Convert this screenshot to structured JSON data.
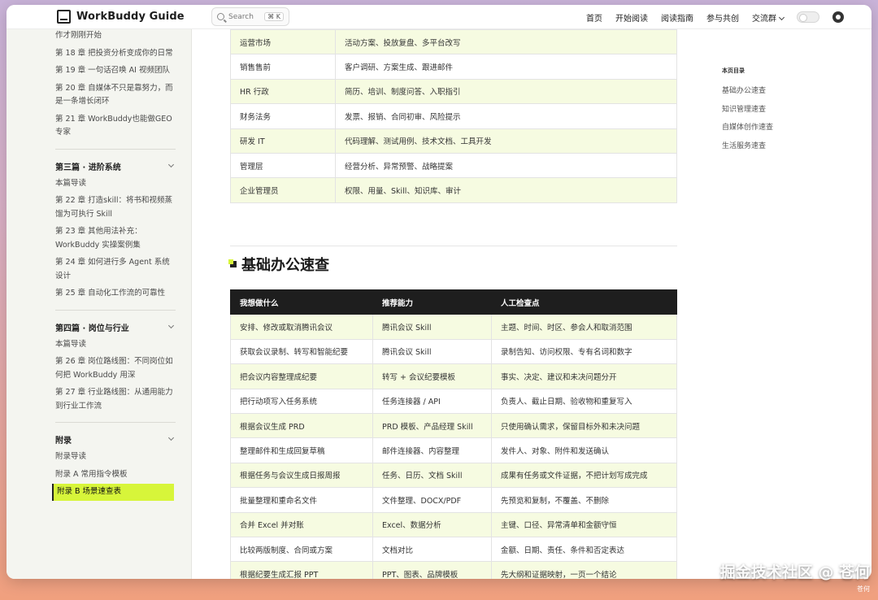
{
  "header": {
    "logo_text": "WorkBuddy Guide",
    "search_placeholder": "Search",
    "search_shortcut": "⌘ K",
    "nav": [
      "首页",
      "开始阅读",
      "阅读指南",
      "参与共创",
      "交流群"
    ]
  },
  "sidebar": {
    "top_links": [
      "作才刚刚开始",
      "第 18 章 把投资分析变成你的日常",
      "第 19 章 一句话召唤 AI 视频团队",
      "第 20 章 自媒体不只是靠努力，而是一条增长闭环",
      "第 21 章 WorkBuddy也能做GEO专家"
    ],
    "sections": [
      {
        "title": "第三篇 · 进阶系统",
        "items": [
          "本篇导读",
          "第 22 章 打造skill：将书和视频蒸馏为可执行 Skill",
          "第 23 章 其他用法补充：WorkBuddy 实操案例集",
          "第 24 章 如何进行多 Agent 系统设计",
          "第 25 章 自动化工作流的可靠性"
        ]
      },
      {
        "title": "第四篇 · 岗位与行业",
        "items": [
          "本篇导读",
          "第 26 章 岗位路线图：不同岗位如何把 WorkBuddy 用深",
          "第 27 章 行业路线图：从通用能力到行业工作流"
        ]
      },
      {
        "title": "附录",
        "items": [
          "附录导读",
          "附录 A 常用指令模板"
        ],
        "active": "附录 B 场景速查表"
      }
    ]
  },
  "roles_table": {
    "rows": [
      [
        "运营市场",
        "活动方案、投放复盘、多平台改写"
      ],
      [
        "销售售前",
        "客户调研、方案生成、跟进邮件"
      ],
      [
        "HR 行政",
        "简历、培训、制度问答、入职指引"
      ],
      [
        "财务法务",
        "发票、报销、合同初审、风险提示"
      ],
      [
        "研发 IT",
        "代码理解、测试用例、技术文档、工具开发"
      ],
      [
        "管理层",
        "经营分析、异常预警、战略提案"
      ],
      [
        "企业管理员",
        "权限、用量、Skill、知识库、审计"
      ]
    ]
  },
  "section": {
    "heading": "基础办公速查"
  },
  "office_table": {
    "headers": [
      "我想做什么",
      "推荐能力",
      "人工检查点"
    ],
    "rows": [
      [
        "安排、修改或取消腾讯会议",
        "腾讯会议 Skill",
        "主题、时间、时区、参会人和取消范围"
      ],
      [
        "获取会议录制、转写和智能纪要",
        "腾讯会议 Skill",
        "录制告知、访问权限、专有名词和数字"
      ],
      [
        "把会议内容整理成纪要",
        "转写 + 会议纪要模板",
        "事实、决定、建议和未决问题分开"
      ],
      [
        "把行动项写入任务系统",
        "任务连接器 / API",
        "负责人、截止日期、验收物和重复写入"
      ],
      [
        "根据会议生成 PRD",
        "PRD 模板、产品经理 Skill",
        "只使用确认需求，保留目标外和未决问题"
      ],
      [
        "整理邮件和生成回复草稿",
        "邮件连接器、内容整理",
        "发件人、对象、附件和发送确认"
      ],
      [
        "根据任务与会议生成日报周报",
        "任务、日历、文档 Skill",
        "成果有任务或文件证据，不把计划写成完成"
      ],
      [
        "批量整理和重命名文件",
        "文件整理、DOCX/PDF",
        "先预览和复制，不覆盖、不删除"
      ],
      [
        "合并 Excel 并对账",
        "Excel、数据分析",
        "主键、口径、异常清单和金额守恒"
      ],
      [
        "比较两版制度、合同或方案",
        "文档对比",
        "金额、日期、责任、条件和否定表达"
      ],
      [
        "根据纪要生成汇报 PPT",
        "PPT、图表、品牌模板",
        "先大纲和证据映射，一页一个结论"
      ]
    ]
  },
  "toc": {
    "title": "本页目录",
    "items": [
      "基础办公速查",
      "知识管理速查",
      "自媒体创作速查",
      "生活服务速查"
    ]
  },
  "watermark": {
    "main": "掘金技术社区 @ 苍何",
    "small": "苍何"
  }
}
